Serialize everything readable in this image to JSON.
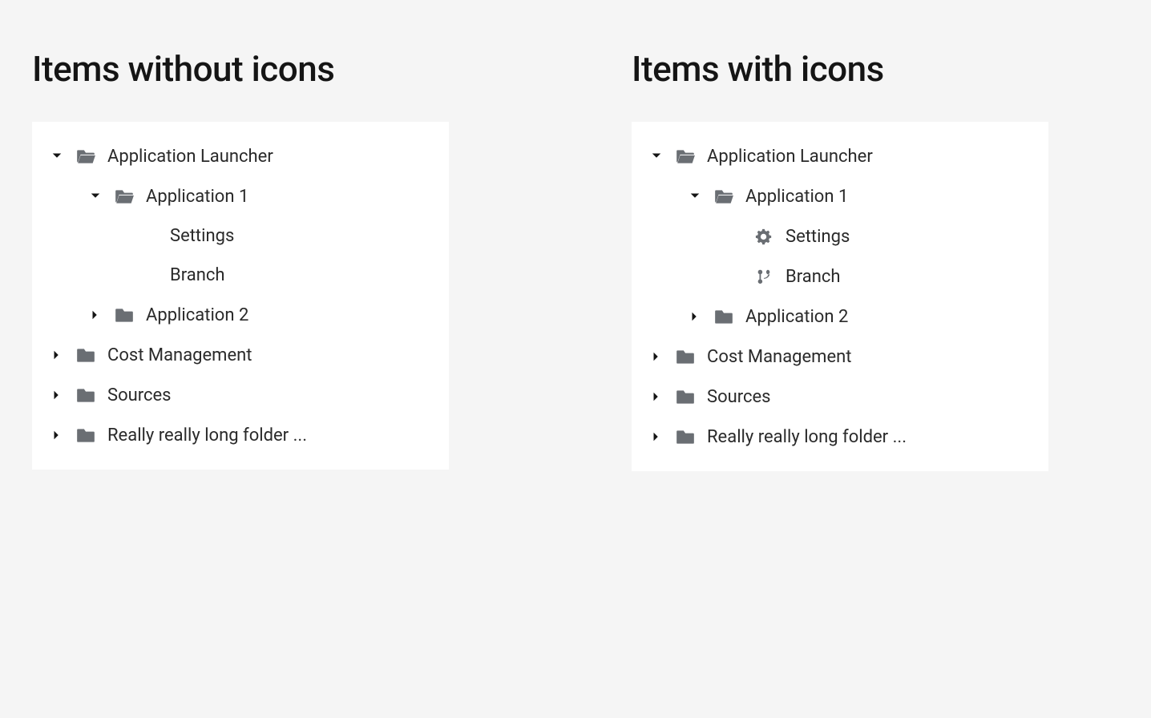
{
  "sections": {
    "left_title": "Items without icons",
    "right_title": "Items with icons"
  },
  "tree": {
    "app_launcher": "Application Launcher",
    "app1": "Application 1",
    "settings": "Settings",
    "branch": "Branch",
    "app2": "Application 2",
    "cost_mgmt": "Cost Management",
    "sources": "Sources",
    "long_folder": "Really really long folder ..."
  }
}
